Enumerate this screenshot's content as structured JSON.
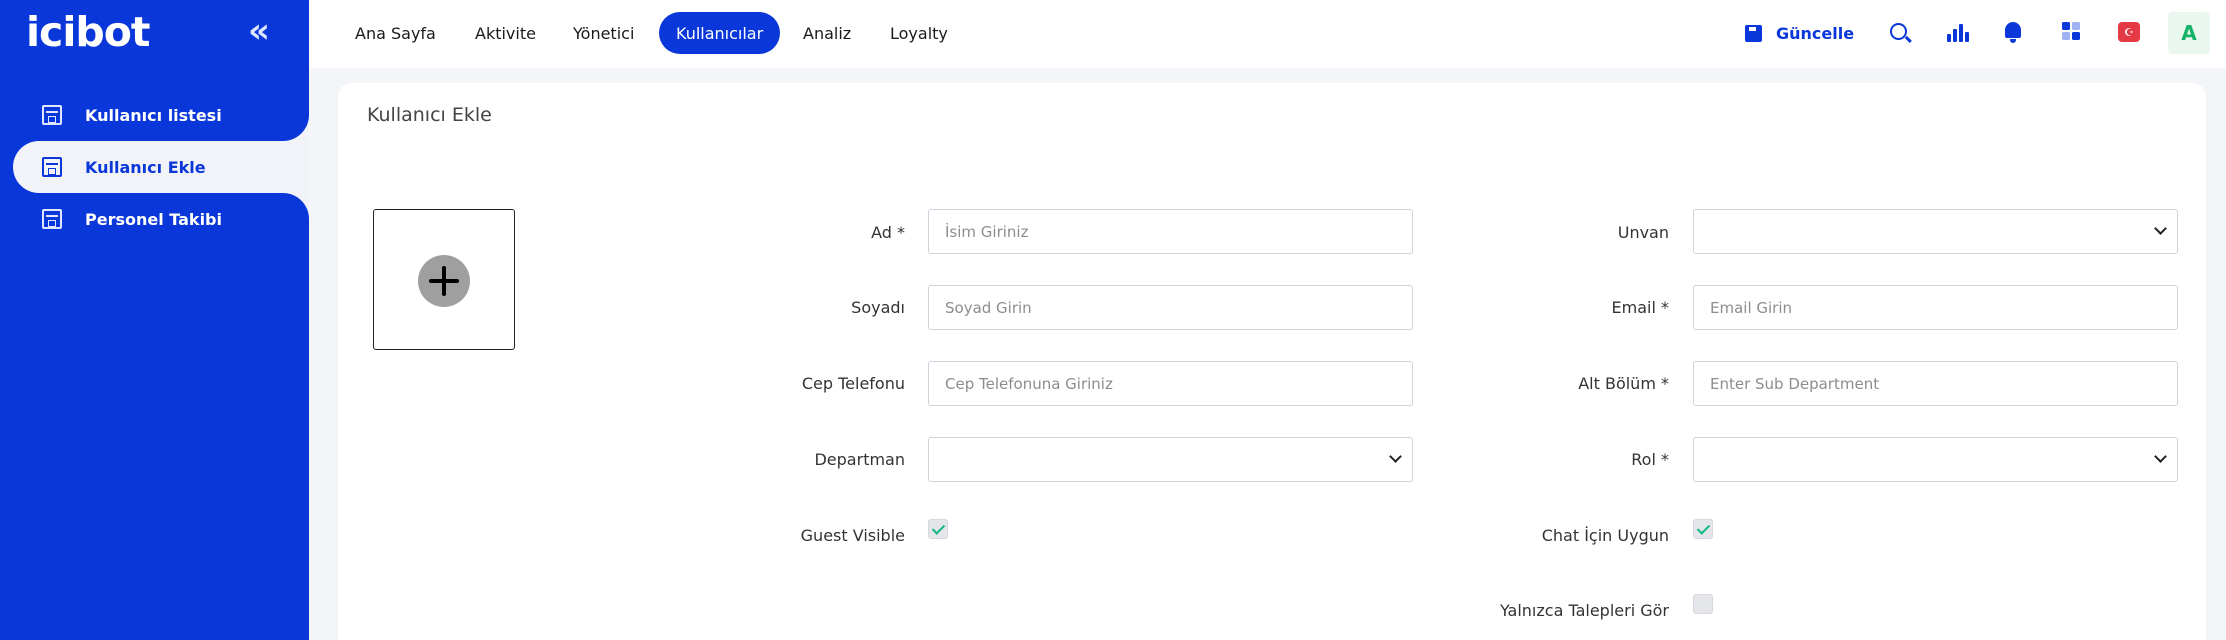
{
  "app": {
    "logo_text": "icibot"
  },
  "sidebar": {
    "items": [
      {
        "label": "Kullanıcı listesi"
      },
      {
        "label": "Kullanıcı Ekle"
      },
      {
        "label": "Personel Takibi"
      }
    ]
  },
  "topbar": {
    "nav": [
      {
        "label": "Ana Sayfa"
      },
      {
        "label": "Aktivite"
      },
      {
        "label": "Yönetici"
      },
      {
        "label": "Kullanıcılar"
      },
      {
        "label": "Analiz"
      },
      {
        "label": "Loyalty"
      }
    ],
    "active_nav": "Kullanıcılar",
    "save_label": "Güncelle",
    "avatar_letter": "A",
    "flag_symbol": "☪"
  },
  "form": {
    "title": "Kullanıcı Ekle",
    "left": {
      "ad": {
        "label": "Ad *",
        "placeholder": "İsim Giriniz",
        "value": ""
      },
      "soyadi": {
        "label": "Soyadı",
        "placeholder": "Soyad Girin",
        "value": ""
      },
      "cep": {
        "label": "Cep Telefonu",
        "placeholder": "Cep Telefonuna Giriniz",
        "value": ""
      },
      "departman": {
        "label": "Departman",
        "value": ""
      },
      "guest_visible": {
        "label": "Guest Visible",
        "checked": true
      }
    },
    "right": {
      "unvan": {
        "label": "Unvan",
        "value": ""
      },
      "email": {
        "label": "Email *",
        "placeholder": "Email Girin",
        "value": ""
      },
      "alt_bolum": {
        "label": "Alt Bölüm *",
        "placeholder": "Enter Sub Department",
        "value": ""
      },
      "rol": {
        "label": "Rol *",
        "value": ""
      },
      "chat": {
        "label": "Chat İçin Uygun",
        "checked": true
      },
      "yalnizca": {
        "label": "Yalnızca Talepleri Gör",
        "checked": false
      }
    }
  },
  "colors": {
    "primary": "#0a37d9",
    "check": "#10b981",
    "avatar_bg": "#e9f7ef",
    "avatar_fg": "#17b26a"
  }
}
